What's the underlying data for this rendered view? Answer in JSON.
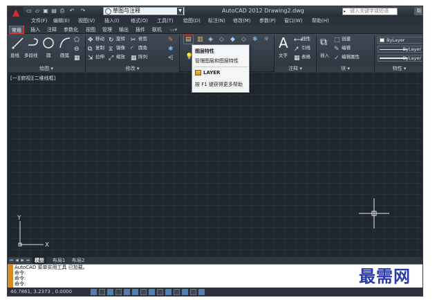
{
  "titlebar": {
    "workspace": "草图与注释",
    "app_title": "AutoCAD 2012   Drawing2.dwg",
    "search_placeholder": "键入关键字或短语",
    "help": "帮"
  },
  "menus": [
    "文件(F)",
    "编辑(E)",
    "视图(V)",
    "插入(I)",
    "格式(O)",
    "工具(T)",
    "绘图(D)",
    "标注(N)",
    "修改(M)",
    "参数(P)",
    "窗口(W)",
    "帮助(H)"
  ],
  "ribbon_tabs": [
    "常用",
    "插入",
    "注释",
    "参数化",
    "视图",
    "管理",
    "输出",
    "插件",
    "联机"
  ],
  "ribbon": {
    "draw": {
      "line": "直线",
      "polyline": "多段线",
      "circle": "圆",
      "arc": "圆弧"
    },
    "modify": {
      "move": "移动",
      "rotate": "旋转",
      "trim": "修剪",
      "copy": "复制",
      "mirror": "镜像",
      "fillet": "圆角",
      "stretch": "拉伸",
      "scale": "缩放",
      "array": "阵列"
    },
    "annotation": {
      "text": "文字",
      "linear": "线性",
      "leader": "引线",
      "table": "表格"
    },
    "block": {
      "insert": "插入",
      "create": "创建",
      "edit": "编辑",
      "edit_attr": "编辑属性"
    },
    "properties": {
      "color": "ByLayer",
      "linetype": "ByLayer",
      "lineweight": "ByLayer"
    },
    "panel_titles": [
      "绘图 ▾",
      "修改 ▾",
      "注释 ▾",
      "块 ▾",
      "特性 ▾"
    ]
  },
  "tooltip": {
    "title": "图层特性",
    "desc": "管理图层和图层特性",
    "command": "LAYER",
    "help": "按 F1 键获得更多帮助"
  },
  "viewport": {
    "label": "[一][俯视][二维线框]"
  },
  "layout_tabs": [
    "模型",
    "布局1",
    "布局2"
  ],
  "command": {
    "lines": [
      "AutoCAD 菜单实用工具 已加载。",
      "命令:",
      "命令:",
      "命令:"
    ]
  },
  "watermark": "最需网",
  "status": {
    "coords": "40.7861, 3.2373 , 0.0000"
  }
}
